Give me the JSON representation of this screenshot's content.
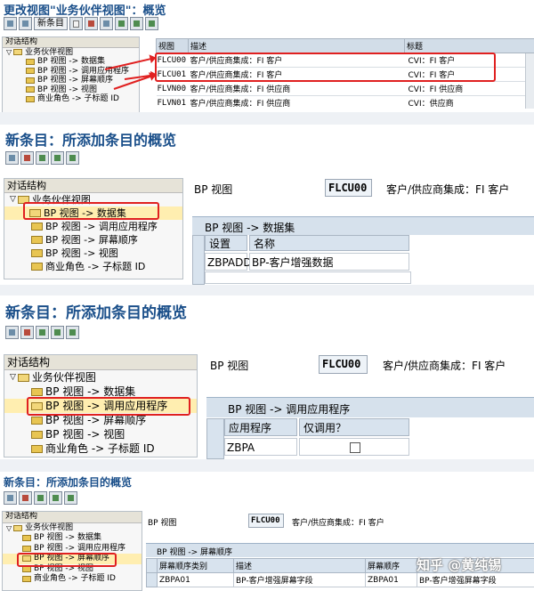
{
  "s1": {
    "title": "更改视图\"业务伙伴视图\"：概览",
    "new_entry": "新条目",
    "tree_header": "对话结构",
    "tree_items": [
      "业务伙伴视图",
      "BP 视图 -> 数据集",
      "BP 视图 -> 调用应用程序",
      "BP 视图 -> 屏幕顺序",
      "BP 视图 -> 视图",
      "商业角色 -> 子标题 ID"
    ],
    "columns": [
      "视图",
      "描述",
      "标题"
    ],
    "rows": [
      {
        "view": "FLCU00",
        "desc": "客户/供应商集成：FI 客户",
        "title": "CVI：FI 客户"
      },
      {
        "view": "FLCU01",
        "desc": "客户/供应商集成：FI 客户",
        "title": "CVI：FI 客户"
      },
      {
        "view": "FLVN00",
        "desc": "客户/供应商集成：FI 供应商",
        "title": "CVI：FI 供应商"
      },
      {
        "view": "FLVN01",
        "desc": "客户/供应商集成：FI 供应商",
        "title": "CVI：供应商"
      }
    ]
  },
  "s2": {
    "title": "新条目：所添加条目的概览",
    "tree_header": "对话结构",
    "tree_items": [
      "业务伙伴视图",
      "BP 视图 -> 数据集",
      "BP 视图 -> 调用应用程序",
      "BP 视图 -> 屏幕顺序",
      "BP 视图 -> 视图",
      "商业角色 -> 子标题 ID"
    ],
    "bp_view_label": "BP 视图",
    "bp_view_value": "FLCU00",
    "bp_view_desc": "客户/供应商集成：FI 客户",
    "panel_title": "BP 视图 -> 数据集",
    "columns": [
      "设置",
      "名称"
    ],
    "row": {
      "setting": "ZBPADD",
      "name": "BP-客户增强数据"
    }
  },
  "s3": {
    "title": "新条目：所添加条目的概览",
    "tree_header": "对话结构",
    "tree_items": [
      "业务伙伴视图",
      "BP 视图 -> 数据集",
      "BP 视图 -> 调用应用程序",
      "BP 视图 -> 屏幕顺序",
      "BP 视图 -> 视图",
      "商业角色 -> 子标题 ID"
    ],
    "bp_view_label": "BP 视图",
    "bp_view_value": "FLCU00",
    "bp_view_desc": "客户/供应商集成：FI 客户",
    "panel_title": "BP 视图 -> 调用应用程序",
    "columns": [
      "应用程序",
      "仅调用？"
    ],
    "row": {
      "app": "ZBPA",
      "only_call": false
    }
  },
  "s4": {
    "title": "新条目：所添加条目的概览",
    "tree_header": "对话结构",
    "tree_items": [
      "业务伙伴视图",
      "BP 视图 -> 数据集",
      "BP 视图 -> 调用应用程序",
      "BP 视图 -> 屏幕顺序",
      "BP 视图 -> 视图",
      "商业角色 -> 子标题 ID"
    ],
    "bp_view_label": "BP 视图",
    "bp_view_value": "FLCU00",
    "bp_view_desc": "客户/供应商集成：FI 客户",
    "panel_title": "BP 视图 -> 屏幕顺序",
    "columns": [
      "屏幕顺序类别",
      "描述",
      "屏幕顺序",
      ""
    ],
    "row": {
      "cat": "ZBPA01",
      "desc": "BP-客户增强屏幕字段",
      "seq": "ZBPA01",
      "desc2": "BP-客户增强屏幕字段"
    }
  },
  "watermark": "知乎 @黄纯锡"
}
